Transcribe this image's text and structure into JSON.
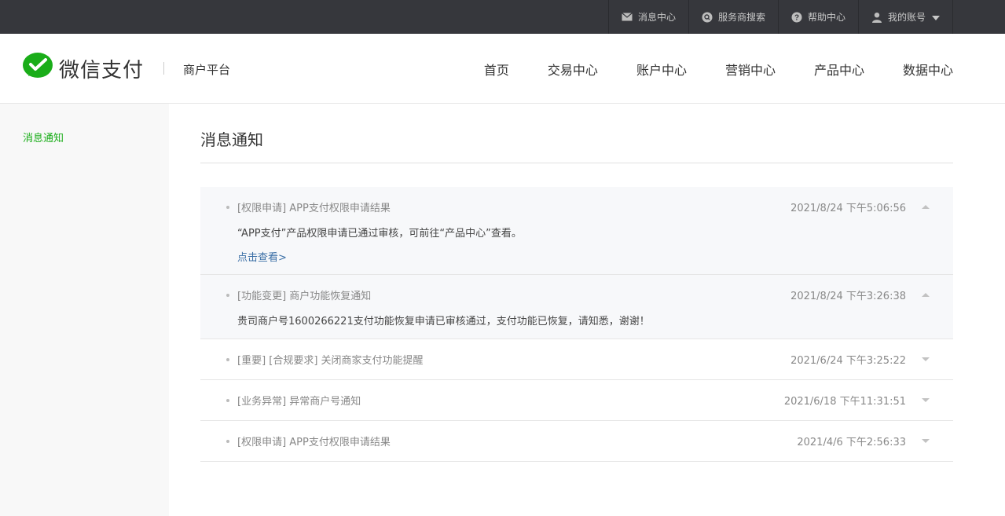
{
  "topbar": {
    "items": [
      {
        "label": "消息中心",
        "icon": "mail-icon"
      },
      {
        "label": "服务商搜索",
        "icon": "search-icon"
      },
      {
        "label": "帮助中心",
        "icon": "help-icon"
      },
      {
        "label": "我的账号",
        "icon": "user-icon"
      }
    ]
  },
  "header": {
    "logo_text": "微信支付",
    "sub_title": "商户平台",
    "nav": [
      "首页",
      "交易中心",
      "账户中心",
      "营销中心",
      "产品中心",
      "数据中心"
    ]
  },
  "sidebar": {
    "items": [
      "消息通知"
    ]
  },
  "main": {
    "page_title": "消息通知",
    "messages": [
      {
        "title": "[权限申请] APP支付权限申请结果",
        "time": "2021/8/24 下午5:06:56",
        "expanded": true,
        "body": "“APP支付”产品权限申请已通过审核，可前往“产品中心”查看。",
        "link": "点击查看>"
      },
      {
        "title": "[功能变更] 商户功能恢复通知",
        "time": "2021/8/24 下午3:26:38",
        "expanded": true,
        "body": "贵司商户号1600266221支付功能恢复申请已审核通过，支付功能已恢复，请知悉，谢谢！"
      },
      {
        "title": "[重要] [合规要求] 关闭商家支付功能提醒",
        "time": "2021/6/24 下午3:25:22",
        "expanded": false
      },
      {
        "title": "[业务异常] 异常商户号通知",
        "time": "2021/6/18 下午11:31:51",
        "expanded": false
      },
      {
        "title": "[权限申请] APP支付权限申请结果",
        "time": "2021/4/6 下午2:56:33",
        "expanded": false
      }
    ]
  },
  "colors": {
    "brand_green": "#1aad19",
    "topbar_bg": "#36373c",
    "link_blue": "#3b6fa6"
  }
}
